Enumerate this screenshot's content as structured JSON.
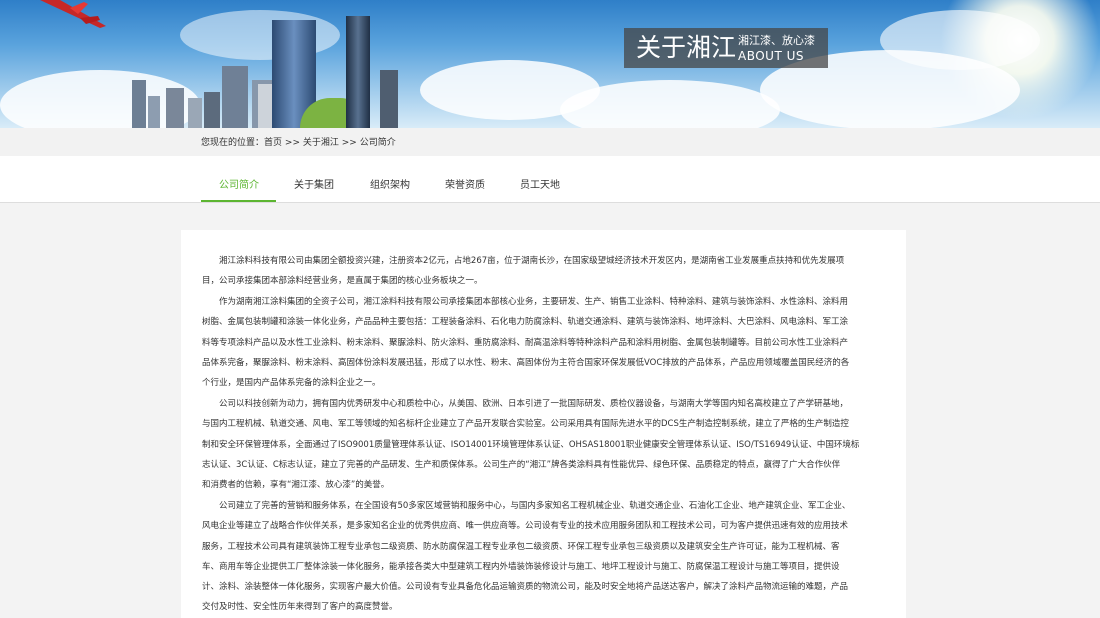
{
  "banner": {
    "title": "关于湘江",
    "subtitle_cn": "湘江漆、放心漆",
    "subtitle_en": "ABOUT US"
  },
  "breadcrumb": {
    "prefix": "您现在的位置：",
    "items": [
      "首页",
      "关于湘江",
      "公司简介"
    ],
    "separator": ">>"
  },
  "tabs": [
    {
      "label": "公司简介",
      "active": true
    },
    {
      "label": "关于集团",
      "active": false
    },
    {
      "label": "组织架构",
      "active": false
    },
    {
      "label": "荣誉资质",
      "active": false
    },
    {
      "label": "员工天地",
      "active": false
    }
  ],
  "colors": {
    "accent": "#5cb531"
  },
  "content": {
    "paragraphs": [
      [
        "　　湘江涂料科技有限公司由集团全额投资兴建，注册资本2亿元，占地267亩，位于湖南长沙，在国家级望城经济技术开发区内，是湖南省工业发展重点扶持和优先发展项",
        "目，公司承接集团本部涂料经营业务，是直属于集团的核心业务板块之一。"
      ],
      [
        "　　作为湖南湘江涂料集团的全资子公司，湘江涂料科技有限公司承接集团本部核心业务，主要研发、生产、销售工业涂料、特种涂料、建筑与装饰涂料、水性涂料、涂料用",
        "树脂、金属包装制罐和涂装一体化业务，产品品种主要包括：工程装备涂料、石化电力防腐涂料、轨道交通涂料、建筑与装饰涂料、地坪涂料、大巴涂料、风电涂料、军工涂",
        "料等专项涂料产品以及水性工业涂料、粉末涂料、聚脲涂料、防火涂料、重防腐涂料、耐高温涂料等特种涂料产品和涂料用树脂、金属包装制罐等。目前公司水性工业涂料产",
        "品体系完备，聚脲涂料、粉末涂料、高固体份涂料发展迅猛，形成了以水性、粉末、高固体份为主符合国家环保发展低VOC排放的产品体系，产品应用领域覆盖国民经济的各",
        "个行业，是国内产品体系完备的涂料企业之一。"
      ],
      [
        "　　公司以科技创新为动力，拥有国内优秀研发中心和质检中心，从美国、欧洲、日本引进了一批国际研发、质检仪器设备，与湖南大学等国内知名高校建立了产学研基地，",
        "与国内工程机械、轨道交通、风电、军工等领域的知名标杆企业建立了产品开发联合实验室。公司采用具有国际先进水平的DCS生产制造控制系统，建立了严格的生产制造控",
        "制和安全环保管理体系，全面通过了ISO9001质量管理体系认证、ISO14001环境管理体系认证、OHSAS18001职业健康安全管理体系认证、ISO/TS16949认证、中国环境标",
        "志认证、3C认证、C标志认证，建立了完善的产品研发、生产和质保体系。公司生产的“湘江”牌各类涂料具有性能优异、绿色环保、品质稳定的特点，赢得了广大合作伙伴",
        "和消费者的信赖，享有“湘江漆、放心漆”的美誉。"
      ],
      [
        "　　公司建立了完善的营销和服务体系，在全国设有50多家区域营销和服务中心，与国内多家知名工程机械企业、轨道交通企业、石油化工企业、地产建筑企业、军工企业、",
        "风电企业等建立了战略合作伙伴关系，是多家知名企业的优秀供应商、唯一供应商等。公司设有专业的技术应用服务团队和工程技术公司，可为客户提供迅速有效的应用技术",
        "服务，工程技术公司具有建筑装饰工程专业承包二级资质、防水防腐保温工程专业承包二级资质、环保工程专业承包三级资质以及建筑安全生产许可证，能为工程机械、客",
        "车、商用车等企业提供工厂整体涂装一体化服务，能承接各类大中型建筑工程内外墙装饰装修设计与施工、地坪工程设计与施工、防腐保温工程设计与施工等项目，提供设",
        "计、涂料、涂装整体一体化服务，实现客户最大价值。公司设有专业具备危化品运输资质的物流公司，能及时安全地将产品送达客户，解决了涂料产品物流运输的难题，产品",
        "交付及时性、安全性历年来得到了客户的高度赞誉。"
      ]
    ]
  }
}
